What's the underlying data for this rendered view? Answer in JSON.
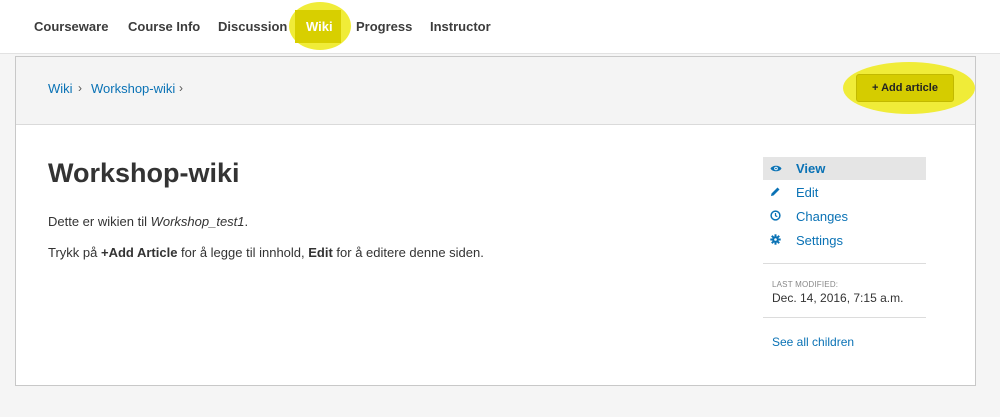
{
  "topnav": {
    "tabs": [
      {
        "label": "Courseware"
      },
      {
        "label": "Course Info"
      },
      {
        "label": "Discussion"
      },
      {
        "label": "Wiki"
      },
      {
        "label": "Progress"
      },
      {
        "label": "Instructor"
      }
    ],
    "active_tab": "Wiki"
  },
  "breadcrumb": {
    "items": [
      "Wiki",
      "Workshop-wiki"
    ],
    "separator": "›"
  },
  "toolbar": {
    "add_article_label": "+ Add article"
  },
  "article": {
    "title": "Workshop-wiki",
    "para1_prefix": "Dette er wikien til ",
    "para1_italic": "Workshop_test1",
    "para1_suffix": ".",
    "para2_prefix": "Trykk på ",
    "para2_bold1": "+Add Article",
    "para2_mid": " for å legge til innhold, ",
    "para2_bold2": "Edit",
    "para2_suffix": " for å editere denne siden."
  },
  "sidebar": {
    "items": [
      {
        "label": "View",
        "icon": "eye-icon"
      },
      {
        "label": "Edit",
        "icon": "pencil-icon"
      },
      {
        "label": "Changes",
        "icon": "clock-icon"
      },
      {
        "label": "Settings",
        "icon": "gear-icon"
      }
    ],
    "last_modified_label": "LAST MODIFIED:",
    "last_modified_value": "Dec. 14, 2016, 7:15 a.m.",
    "see_all_children": "See all children"
  },
  "colors": {
    "link": "#0a72b5",
    "highlight": "#f0ec38",
    "button": "#d5cc00"
  }
}
